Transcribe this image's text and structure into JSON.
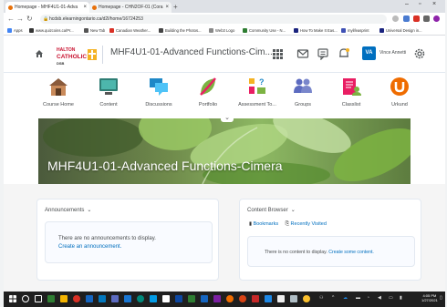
{
  "browser": {
    "tabs": [
      {
        "title": "Homepage - MHF4U1-01-Adva"
      },
      {
        "title": "Homepage - CHN2OF-01 (Cora"
      }
    ],
    "url": "hcdsb.elearningontario.ca/d2l/home/16724253",
    "bookmarks": [
      "Apps",
      "www.quizcoins.ca/Pr...",
      "New Tab",
      "Canadian Weather...",
      "Building the Photos...",
      "Web3 Logo",
      "Community Use - N...",
      "How To Make It Eas...",
      "mylifeasprint",
      "Universal Design in..."
    ]
  },
  "header": {
    "logo_line1": "HALTON",
    "logo_line2": "CATHOLIC",
    "logo_line3": "DSB",
    "course_title": "MHF4U1-01-Advanced Functions-Cim...",
    "user_initials": "VA",
    "user_name": "Vince Annetti"
  },
  "navbar": {
    "items": [
      {
        "label": "Course Home"
      },
      {
        "label": "Content"
      },
      {
        "label": "Discussions"
      },
      {
        "label": "Portfolio"
      },
      {
        "label": "Assessment To..."
      },
      {
        "label": "Groups"
      },
      {
        "label": "Classlist"
      },
      {
        "label": "Urkund"
      }
    ]
  },
  "banner": {
    "title": "MHF4U1-01-Advanced Functions-Cimera"
  },
  "announcements": {
    "title": "Announcements",
    "empty_message": "There are no announcements to display.",
    "create_link": "Create an announcement."
  },
  "content_browser": {
    "title": "Content Browser",
    "bookmarks_link": "Bookmarks",
    "recent_link": "Recently Visited",
    "empty_message": "There is no content to display.",
    "create_link": "Create some content."
  },
  "taskbar": {
    "time": "4:05 PM",
    "date": "1/27/2021"
  },
  "colors": {
    "brand_blue": "#006fbf",
    "taskbar": "#1f1f1f",
    "halton_red": "#c8102e"
  }
}
